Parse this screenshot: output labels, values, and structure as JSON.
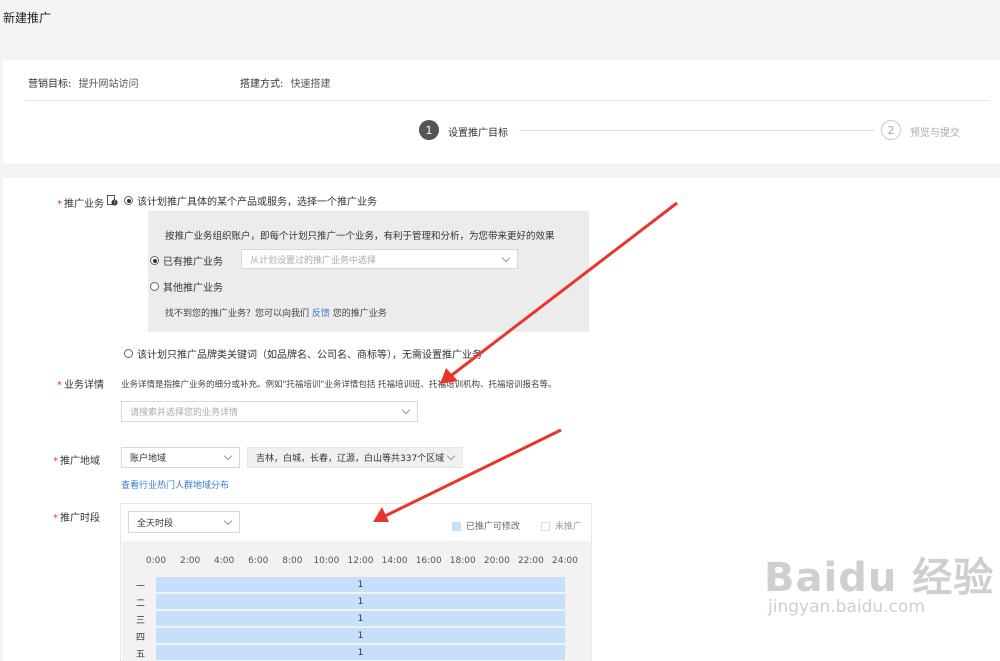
{
  "page": {
    "title": "新建推广"
  },
  "meta": {
    "goal_label": "营销目标:",
    "goal_value": "提升网站访问",
    "method_label": "搭建方式:",
    "method_value": "快速搭建"
  },
  "steps": [
    {
      "num": "1",
      "label": "设置推广目标"
    },
    {
      "num": "2",
      "label": "预览与提交"
    }
  ],
  "business": {
    "label": "推广业务",
    "option_a": "该计划推广具体的某个产品或服务，选择一个推广业务",
    "desc": "按推广业务组织账户，即每个计划只推广一个业务，有利于管理和分析，为您带来更好的效果",
    "existing_label": "已有推广业务",
    "existing_placeholder": "从计划设置过的推广业务中选择",
    "other_label": "其他推广业务",
    "help_prefix": "找不到您的推广业务？您可以向我们",
    "help_link": "反馈",
    "help_suffix": "您的推广业务",
    "option_b": "该计划只推广品牌类关键词（如品牌名、公司名、商标等），无需设置推广业务"
  },
  "detail": {
    "label": "业务详情",
    "desc": "业务详情是指推广业务的细分或补充。例如\"托福培训\"业务详情包括 托福培训班、托福培训机构、托福培训报名等。",
    "placeholder": "请搜索并选择您的业务详情"
  },
  "region": {
    "label": "推广地域",
    "select_value": "账户地域",
    "regions_value": "吉林，白城，长春，辽源，白山等共337个区域",
    "link": "查看行业热门人群地域分布"
  },
  "schedule": {
    "label": "推广时段",
    "select_value": "全天时段",
    "legend_on": "已推广可修改",
    "legend_off": "未推广",
    "legend_on_color": "#c6dffa",
    "hours": [
      "0:00",
      "2:00",
      "4:00",
      "6:00",
      "8:00",
      "10:00",
      "12:00",
      "14:00",
      "16:00",
      "18:00",
      "20:00",
      "22:00",
      "24:00"
    ],
    "days": [
      {
        "name": "一",
        "value": "1"
      },
      {
        "name": "二",
        "value": "1"
      },
      {
        "name": "三",
        "value": "1"
      },
      {
        "name": "四",
        "value": "1"
      },
      {
        "name": "五",
        "value": "1"
      }
    ]
  },
  "watermark": {
    "main": "Baidu 经验",
    "sub": "jingyan.baidu.com"
  },
  "colors": {
    "accent": "#3a7bd5",
    "required": "#e33333",
    "arrow": "#e8362d"
  }
}
